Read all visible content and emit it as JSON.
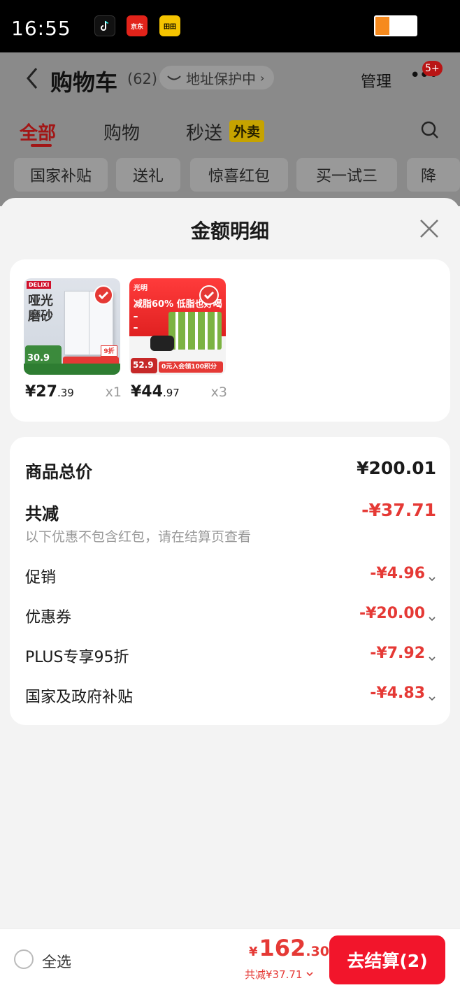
{
  "status_bar": {
    "time": "16:55",
    "app_icons": [
      "tiktok-icon",
      "jd-icon",
      "tian-icon"
    ],
    "app_labels": {
      "jd": "京东",
      "tian": "田田"
    }
  },
  "cart_header": {
    "title": "购物车",
    "count": "(62)",
    "address_protect": "地址保护中",
    "manage": "管理",
    "message_badge": "5+",
    "tabs": [
      {
        "label": "全部",
        "active": true
      },
      {
        "label": "购物",
        "active": false
      },
      {
        "label": "秒送",
        "active": false
      }
    ],
    "tab_tag": "外卖",
    "chips": [
      "国家补贴",
      "送礼",
      "惊喜红包",
      "买一试三",
      "降"
    ]
  },
  "sheet": {
    "title": "金额明细",
    "products": [
      {
        "price_int": "¥27",
        "price_dec": ".39",
        "qty": "x1",
        "img_text_1": "哑光",
        "img_text_2": "磨砂",
        "brand": "DELIXI",
        "tag_price": "30.9",
        "badge": "9折"
      },
      {
        "price_int": "¥44",
        "price_dec": ".97",
        "qty": "x3",
        "brand": "光明",
        "headline": "减脂60% 低脂也好喝",
        "tag_price": "52.9",
        "promo": "0元入会领100积分"
      }
    ],
    "summary": {
      "total_label": "商品总价",
      "total_value": "¥200.01",
      "reduce_label": "共减",
      "reduce_value": "-¥37.71",
      "reduce_note": "以下优惠不包含红包，请在结算页查看",
      "items": [
        {
          "label": "促销",
          "value": "-¥4.96"
        },
        {
          "label": "优惠券",
          "value": "-¥20.00"
        },
        {
          "label": "PLUS专享95折",
          "value": "-¥7.92"
        },
        {
          "label": "国家及政府补贴",
          "value": "-¥4.83"
        }
      ]
    }
  },
  "bottom_bar": {
    "select_all": "全选",
    "total_symbol": "¥",
    "total_int": "162",
    "total_dec": ".30",
    "reduce_summary": "共减¥37.71",
    "checkout": "去结算(2)"
  },
  "colors": {
    "accent_red": "#e53935",
    "checkout_red": "#f2152b",
    "tab_active_dim": "#a21616"
  }
}
